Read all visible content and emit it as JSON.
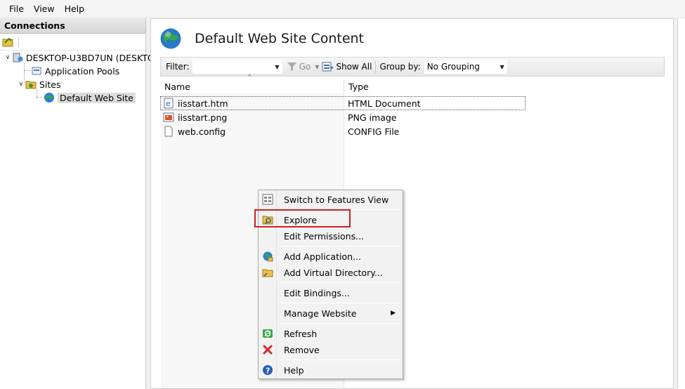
{
  "menubar": {
    "items": [
      "File",
      "View",
      "Help"
    ]
  },
  "connections": {
    "title": "Connections",
    "tree": {
      "server": "DESKTOP-U3BD7UN (DESKTOP",
      "app_pools": "Application Pools",
      "sites": "Sites",
      "default_site": "Default Web Site"
    }
  },
  "main": {
    "title": "Default Web Site Content",
    "filter_label": "Filter:",
    "filter_value": "",
    "go_label": "Go",
    "show_all_label": "Show All",
    "group_by_label": "Group by:",
    "group_by_value": "No Grouping",
    "columns": [
      "Name",
      "Type"
    ],
    "rows": [
      {
        "name": "iisstart.htm",
        "type": "HTML Document",
        "icon": "html-file-icon"
      },
      {
        "name": "iisstart.png",
        "type": "PNG image",
        "icon": "image-file-icon"
      },
      {
        "name": "web.config",
        "type": "CONFIG File",
        "icon": "blank-file-icon"
      }
    ]
  },
  "context_menu": {
    "switch_features": "Switch to Features View",
    "explore": "Explore",
    "edit_permissions": "Edit Permissions...",
    "add_application": "Add Application...",
    "add_virtual_directory": "Add Virtual Directory...",
    "edit_bindings": "Edit Bindings...",
    "manage_website": "Manage Website",
    "refresh": "Refresh",
    "remove": "Remove",
    "help": "Help"
  },
  "colors": {
    "highlight": "#d21f1f",
    "selection": "#dcdcdc"
  }
}
